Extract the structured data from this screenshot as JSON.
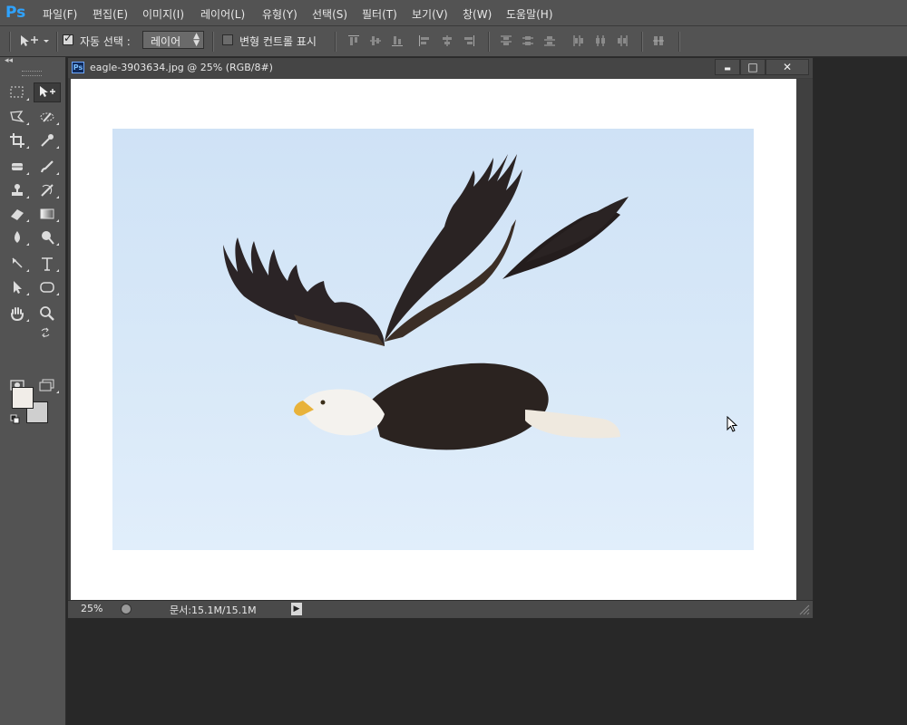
{
  "app": {
    "logo": "Ps"
  },
  "menu": [
    "파일(F)",
    "편집(E)",
    "이미지(I)",
    "레이어(L)",
    "유형(Y)",
    "선택(S)",
    "필터(T)",
    "보기(V)",
    "창(W)",
    "도움말(H)"
  ],
  "options": {
    "auto_select_label": "자동 선택 :",
    "auto_select_checked": true,
    "target_value": "레이어",
    "transform_controls_label": "변형 컨트롤 표시",
    "transform_controls_checked": false
  },
  "document": {
    "title": "eagle-3903634.jpg @ 25% (RGB/8#)",
    "minimize_glyph": "▬",
    "maximize_glyph": "□",
    "close_glyph": "✕",
    "zoom": "25%",
    "doc_size": "문서:15.1M/15.1M",
    "status_arrow_glyph": "▶"
  },
  "colors": {
    "foreground": "#f1ede8",
    "background": "#cfcfcf",
    "sky": "#d6e7f8",
    "eagle_body": "#2a2320",
    "eagle_head": "#f4f2ee",
    "beak": "#e8b23a"
  },
  "tools": [
    "rectangular-marquee-tool",
    "move-tool",
    "polygonal-lasso-tool",
    "quick-selection-tool",
    "crop-tool",
    "eyedropper-tool",
    "spot-healing-brush-tool",
    "brush-tool",
    "clone-stamp-tool",
    "history-brush-tool",
    "eraser-tool",
    "gradient-tool",
    "blur-tool",
    "dodge-tool",
    "pen-tool",
    "type-tool",
    "path-selection-tool",
    "rounded-rectangle-tool",
    "hand-tool",
    "zoom-tool"
  ]
}
